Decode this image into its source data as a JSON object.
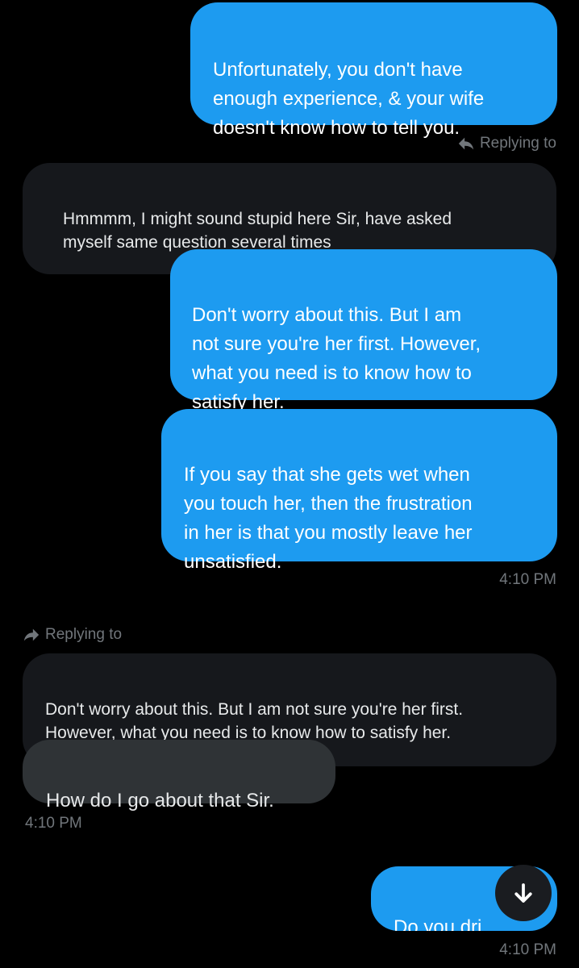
{
  "colors": {
    "background": "#000000",
    "outgoing_bubble": "#1d9bf0",
    "incoming_bubble": "#2f3336",
    "quoted_bubble": "#16181c",
    "meta_text": "#71767b"
  },
  "messages": {
    "out_1": "Unfortunately, you don't have\nenough experience, & your wife\ndoesn't know how to tell you.",
    "reply_1_label": "Replying to",
    "quoted_1": "Hmmmm, I might sound stupid here Sir, have asked\nmyself same question several times",
    "out_2": "Don't worry about this. But I am\nnot sure you're her first. However,\nwhat you need is to know how to\nsatisfy her.",
    "out_3": "If you say that she gets wet when\nyou touch her, then the frustration\nin her is that you mostly leave her\nunsatisfied.",
    "time_1": "4:10 PM",
    "reply_2_label": "Replying to",
    "quoted_2": "Don't worry about this. But I am not sure you're her first.\nHowever, what you need is to know how to satisfy her.",
    "in_1": "How do I go about that Sir.",
    "time_2": "4:10 PM",
    "out_4": "Do you dri",
    "time_3": "4:10 PM"
  },
  "icons": {
    "reply_outgoing": "reply-arrow-icon",
    "reply_incoming": "forward-arrow-icon",
    "scroll_down": "arrow-down-icon"
  }
}
